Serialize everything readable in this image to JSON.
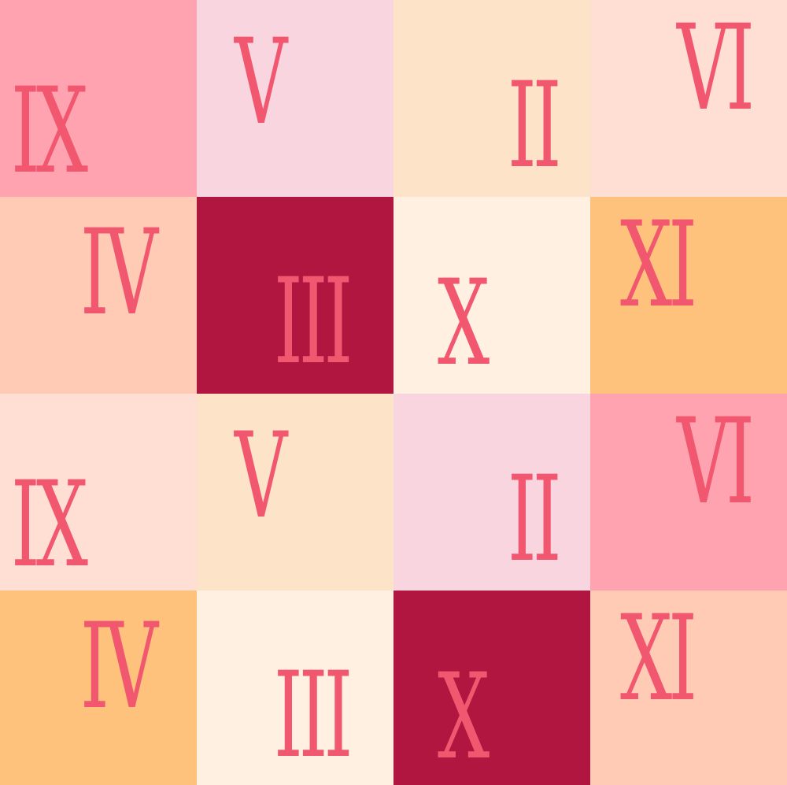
{
  "palette": {
    "numeral_color": "#f25770",
    "pink": "#ffa3b1",
    "blush": "#f9d5e0",
    "peach_light": "#fde3c8",
    "peach": "#ffdfd4",
    "salmon_light": "#ffcbb4",
    "crimson": "#b01640",
    "cream": "#fff0e1",
    "apricot": "#ffc27c"
  },
  "tiles": [
    {
      "numeral": "IX",
      "bg": "#ffa3b1"
    },
    {
      "numeral": "V",
      "bg": "#f9d5e0"
    },
    {
      "numeral": "II",
      "bg": "#fde3c8"
    },
    {
      "numeral": "VI",
      "bg": "#ffdfd4"
    },
    {
      "numeral": "IV",
      "bg": "#ffcbb4"
    },
    {
      "numeral": "III",
      "bg": "#b01640"
    },
    {
      "numeral": "X",
      "bg": "#fff0e1"
    },
    {
      "numeral": "XI",
      "bg": "#ffc27c"
    },
    {
      "numeral": "IX",
      "bg": "#ffdfd4"
    },
    {
      "numeral": "V",
      "bg": "#fde3c8"
    },
    {
      "numeral": "II",
      "bg": "#f9d5e0"
    },
    {
      "numeral": "VI",
      "bg": "#ffa3b1"
    },
    {
      "numeral": "IV",
      "bg": "#ffc27c"
    },
    {
      "numeral": "III",
      "bg": "#fff0e1"
    },
    {
      "numeral": "X",
      "bg": "#b01640"
    },
    {
      "numeral": "XI",
      "bg": "#ffcbb4"
    }
  ]
}
